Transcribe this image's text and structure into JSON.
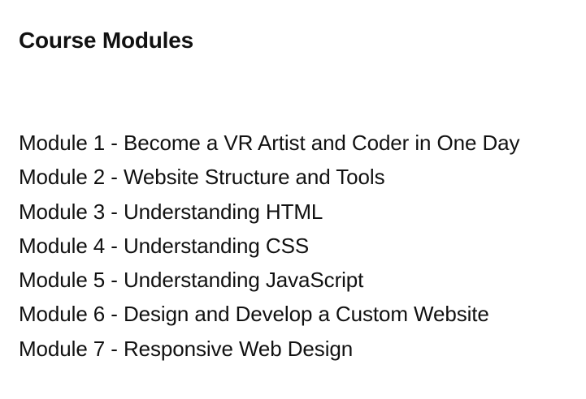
{
  "page": {
    "title": "Course Modules"
  },
  "modules": [
    {
      "label": "Module 1 - Become a VR Artist and Coder in One Day"
    },
    {
      "label": "Module 2 - Website Structure and Tools"
    },
    {
      "label": "Module 3 - Understanding HTML"
    },
    {
      "label": "Module 4 - Understanding CSS"
    },
    {
      "label": "Module 5 - Understanding JavaScript"
    },
    {
      "label": "Module 6 - Design and Develop a Custom Website"
    },
    {
      "label": "Module 7 - Responsive Web Design"
    }
  ]
}
